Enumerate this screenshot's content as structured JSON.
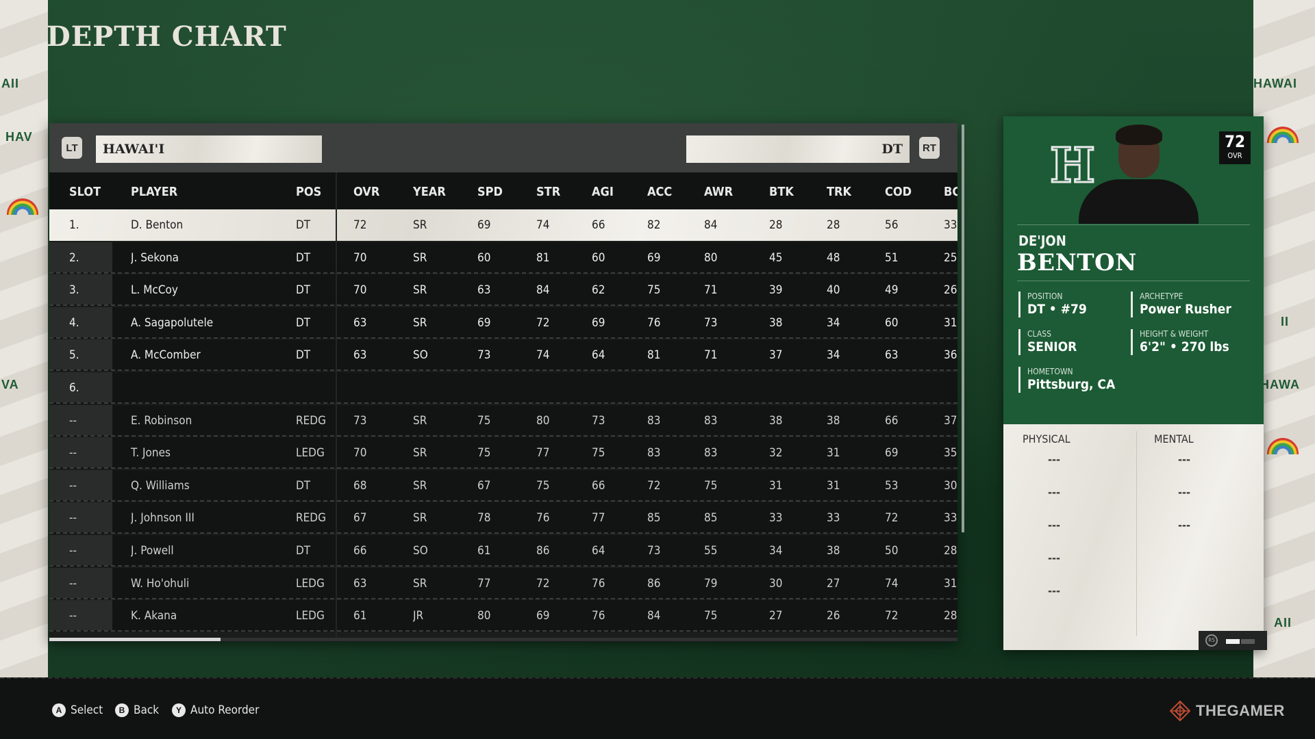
{
  "page_title": "DEPTH CHART",
  "header": {
    "left_bumper": "LT",
    "right_bumper": "RT",
    "team": "HAWAI'I",
    "position": "DT"
  },
  "columns": [
    "SLOT",
    "PLAYER",
    "POS",
    "OVR",
    "YEAR",
    "SPD",
    "STR",
    "AGI",
    "ACC",
    "AWR",
    "BTK",
    "TRK",
    "COD",
    "BC"
  ],
  "rows": [
    {
      "slot": "1.",
      "player": "D. Benton",
      "pos": "DT",
      "ovr": "72",
      "year": "SR",
      "spd": "69",
      "str": "74",
      "agi": "66",
      "acc": "82",
      "awr": "84",
      "btk": "28",
      "trk": "28",
      "cod": "56",
      "bc": "33",
      "selected": true
    },
    {
      "slot": "2.",
      "player": "J. Sekona",
      "pos": "DT",
      "ovr": "70",
      "year": "SR",
      "spd": "60",
      "str": "81",
      "agi": "60",
      "acc": "69",
      "awr": "80",
      "btk": "45",
      "trk": "48",
      "cod": "51",
      "bc": "25"
    },
    {
      "slot": "3.",
      "player": "L. McCoy",
      "pos": "DT",
      "ovr": "70",
      "year": "SR",
      "spd": "63",
      "str": "84",
      "agi": "62",
      "acc": "75",
      "awr": "71",
      "btk": "39",
      "trk": "40",
      "cod": "49",
      "bc": "26"
    },
    {
      "slot": "4.",
      "player": "A. Sagapolutele",
      "pos": "DT",
      "ovr": "63",
      "year": "SR",
      "spd": "69",
      "str": "72",
      "agi": "69",
      "acc": "76",
      "awr": "73",
      "btk": "38",
      "trk": "34",
      "cod": "60",
      "bc": "31"
    },
    {
      "slot": "5.",
      "player": "A. McComber",
      "pos": "DT",
      "ovr": "63",
      "year": "SO",
      "spd": "73",
      "str": "74",
      "agi": "64",
      "acc": "81",
      "awr": "71",
      "btk": "37",
      "trk": "34",
      "cod": "63",
      "bc": "36"
    },
    {
      "slot": "6.",
      "player": "",
      "pos": "",
      "ovr": "",
      "year": "",
      "spd": "",
      "str": "",
      "agi": "",
      "acc": "",
      "awr": "",
      "btk": "",
      "trk": "",
      "cod": "",
      "bc": ""
    },
    {
      "slot": "--",
      "player": "E. Robinson",
      "pos": "REDG",
      "ovr": "73",
      "year": "SR",
      "spd": "75",
      "str": "80",
      "agi": "73",
      "acc": "83",
      "awr": "83",
      "btk": "38",
      "trk": "38",
      "cod": "66",
      "bc": "37"
    },
    {
      "slot": "--",
      "player": "T. Jones",
      "pos": "LEDG",
      "ovr": "70",
      "year": "SR",
      "spd": "75",
      "str": "77",
      "agi": "75",
      "acc": "83",
      "awr": "83",
      "btk": "32",
      "trk": "31",
      "cod": "69",
      "bc": "35"
    },
    {
      "slot": "--",
      "player": "Q. Williams",
      "pos": "DT",
      "ovr": "68",
      "year": "SR",
      "spd": "67",
      "str": "75",
      "agi": "66",
      "acc": "72",
      "awr": "75",
      "btk": "31",
      "trk": "31",
      "cod": "53",
      "bc": "30"
    },
    {
      "slot": "--",
      "player": "J. Johnson III",
      "pos": "REDG",
      "ovr": "67",
      "year": "SR",
      "spd": "78",
      "str": "76",
      "agi": "77",
      "acc": "85",
      "awr": "85",
      "btk": "33",
      "trk": "33",
      "cod": "72",
      "bc": "33"
    },
    {
      "slot": "--",
      "player": "J. Powell",
      "pos": "DT",
      "ovr": "66",
      "year": "SO",
      "spd": "61",
      "str": "86",
      "agi": "64",
      "acc": "73",
      "awr": "55",
      "btk": "34",
      "trk": "38",
      "cod": "50",
      "bc": "28"
    },
    {
      "slot": "--",
      "player": "W. Ho'ohuli",
      "pos": "LEDG",
      "ovr": "63",
      "year": "SR",
      "spd": "77",
      "str": "72",
      "agi": "76",
      "acc": "86",
      "awr": "79",
      "btk": "30",
      "trk": "27",
      "cod": "74",
      "bc": "31"
    },
    {
      "slot": "--",
      "player": "K. Akana",
      "pos": "LEDG",
      "ovr": "61",
      "year": "JR",
      "spd": "80",
      "str": "69",
      "agi": "76",
      "acc": "84",
      "awr": "75",
      "btk": "27",
      "trk": "26",
      "cod": "72",
      "bc": "28"
    }
  ],
  "player_card": {
    "ovr": "72",
    "ovr_label": "OVR",
    "first_name": "DE'JON",
    "last_name": "BENTON",
    "position_label": "POSITION",
    "position_value": "DT • #79",
    "archetype_label": "ARCHETYPE",
    "archetype_value": "Power Rusher",
    "class_label": "CLASS",
    "class_value": "SENIOR",
    "hw_label": "HEIGHT & WEIGHT",
    "hw_value": "6'2\" • 270 lbs",
    "hometown_label": "HOMETOWN",
    "hometown_value": "Pittsburg, CA",
    "physical_label": "PHYSICAL",
    "mental_label": "MENTAL",
    "physical_values": [
      "---",
      "---",
      "---",
      "---",
      "---"
    ],
    "mental_values": [
      "---",
      "---",
      "---"
    ],
    "toggle_label": "RS"
  },
  "background_text": {
    "left": [
      "AII",
      "HAV",
      "VA"
    ],
    "right": [
      "HAWAI",
      "HAWA",
      "II",
      "AII"
    ]
  },
  "controls": [
    {
      "button": "A",
      "label": "Select"
    },
    {
      "button": "B",
      "label": "Back"
    },
    {
      "button": "Y",
      "label": "Auto Reorder"
    }
  ],
  "watermark": "THEGAMER"
}
